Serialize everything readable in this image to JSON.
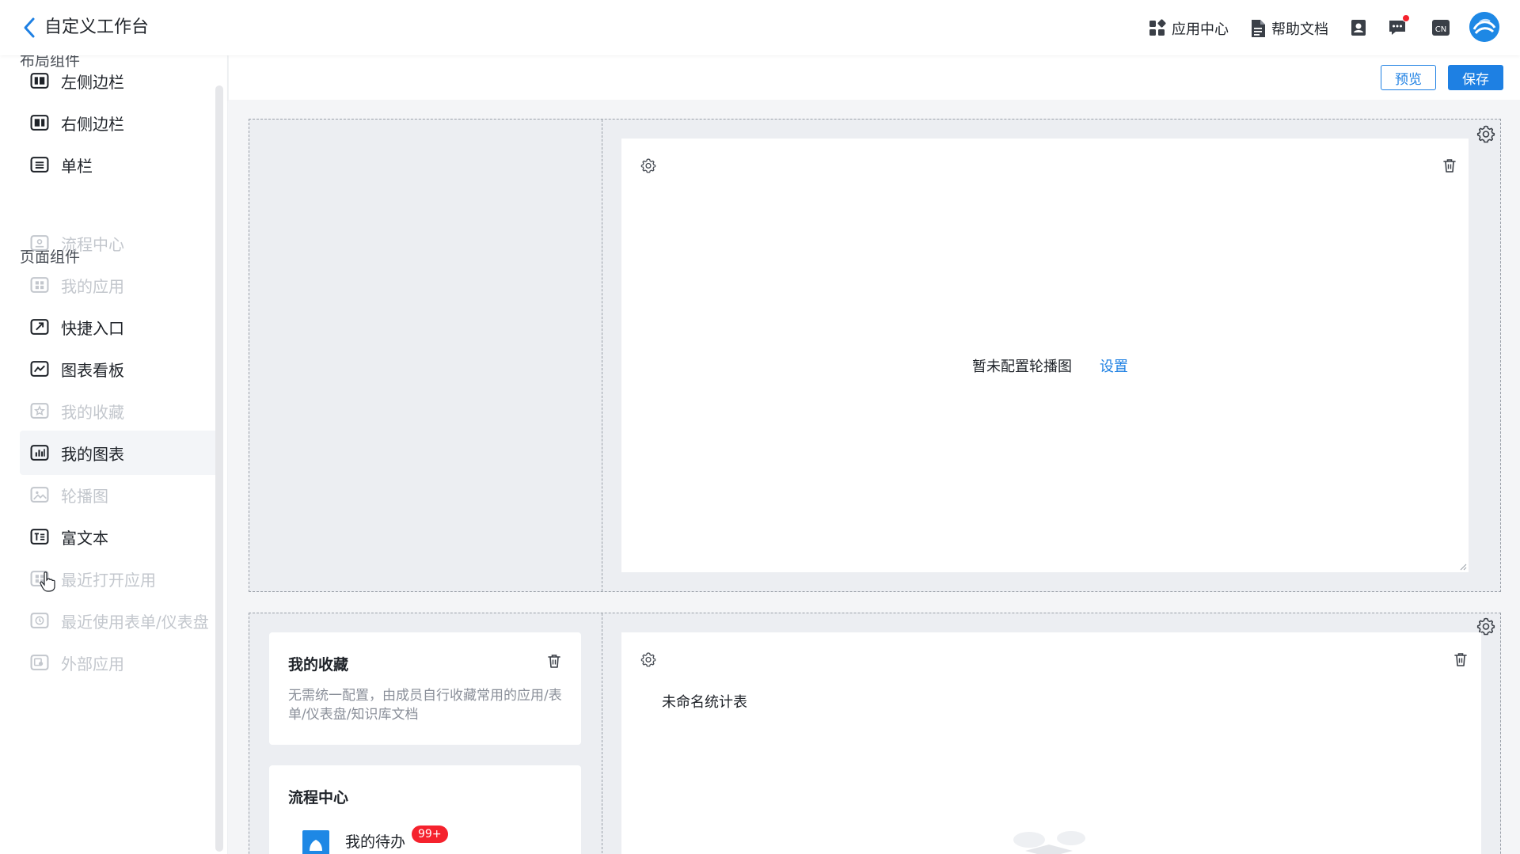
{
  "header": {
    "title": "自定义工作台",
    "app_center": "应用中心",
    "help_docs": "帮助文档",
    "lang": "CN"
  },
  "sidebar": {
    "layout_section": "布局组件",
    "layout_items": [
      {
        "label": "左侧边栏",
        "icon": "left-sidebar-layout-icon",
        "disabled": false
      },
      {
        "label": "右侧边栏",
        "icon": "right-sidebar-layout-icon",
        "disabled": false
      },
      {
        "label": "单栏",
        "icon": "single-column-icon",
        "disabled": false
      }
    ],
    "page_section": "页面组件",
    "page_items": [
      {
        "label": "流程中心",
        "icon": "process-center-icon",
        "disabled": true
      },
      {
        "label": "我的应用",
        "icon": "my-apps-icon",
        "disabled": true
      },
      {
        "label": "快捷入口",
        "icon": "shortcut-icon",
        "disabled": false
      },
      {
        "label": "图表看板",
        "icon": "chart-board-icon",
        "disabled": false
      },
      {
        "label": "我的收藏",
        "icon": "favorites-icon",
        "disabled": true
      },
      {
        "label": "我的图表",
        "icon": "my-charts-icon",
        "disabled": false
      },
      {
        "label": "轮播图",
        "icon": "carousel-icon",
        "disabled": true
      },
      {
        "label": "富文本",
        "icon": "rich-text-icon",
        "disabled": false
      },
      {
        "label": "最近打开应用",
        "icon": "recent-apps-icon",
        "disabled": true
      },
      {
        "label": "最近使用表单/仪表盘",
        "icon": "recent-forms-icon",
        "disabled": true
      },
      {
        "label": "外部应用",
        "icon": "external-apps-icon",
        "disabled": true
      }
    ]
  },
  "toolbar": {
    "preview_label": "预览",
    "save_label": "保存"
  },
  "canvas": {
    "carousel_empty": "暂未配置轮播图",
    "carousel_setup": "设置",
    "favorites_title": "我的收藏",
    "favorites_desc": "无需统一配置，由成员自行收藏常用的应用/表单/仪表盘/知识库文档",
    "process_title": "流程中心",
    "todo_label": "我的待办",
    "todo_badge": "99+",
    "chart_title": "未命名统计表"
  },
  "colors": {
    "accent": "#1e80e3",
    "badge": "#f5222d",
    "disabled_text": "#c3c7cd"
  }
}
